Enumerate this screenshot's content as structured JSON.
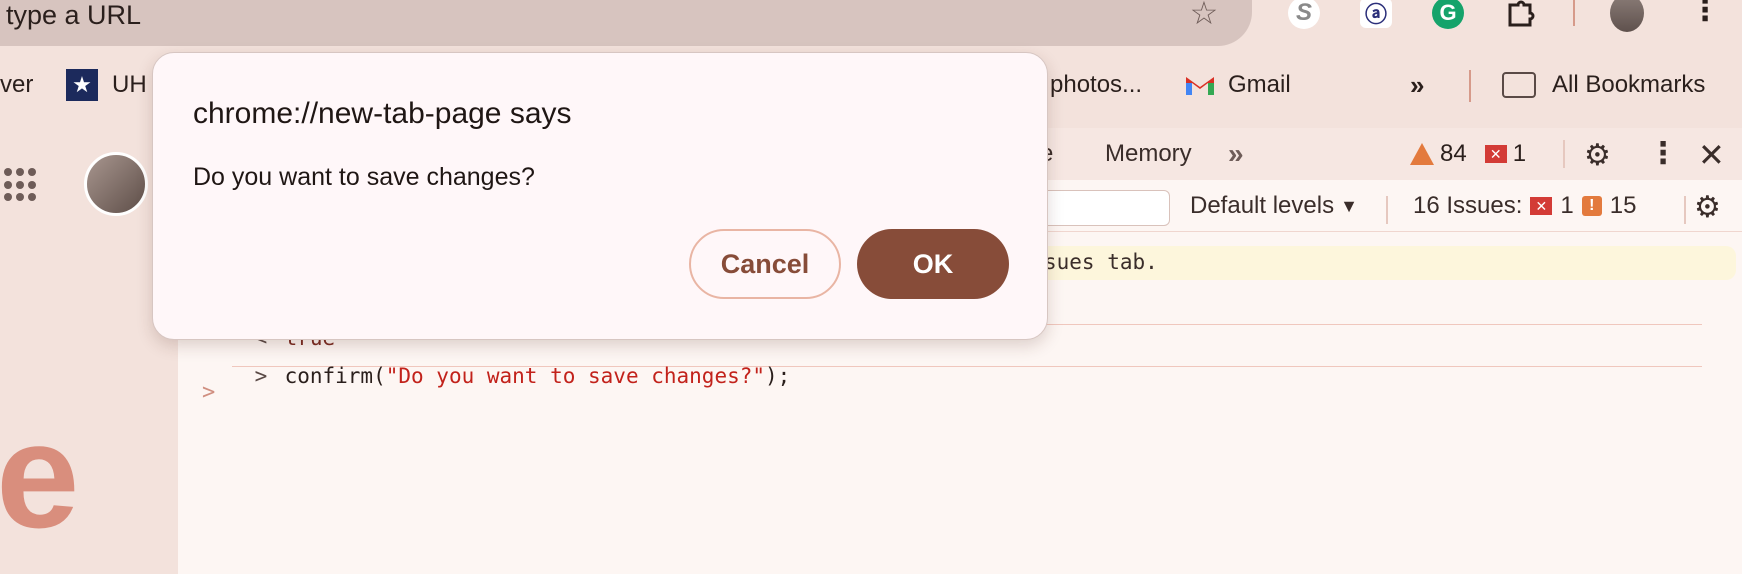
{
  "omnibox": {
    "text": "type a URL"
  },
  "bookmarks": {
    "ver_label": "ver",
    "uh_label": "UH",
    "photos_label": "photos...",
    "gmail_label": "Gmail",
    "more_label": "»",
    "all_label": "All Bookmarks"
  },
  "devtools": {
    "tab_partial": "e",
    "memory_tab": "Memory",
    "more_tabs": "»",
    "warnings_count": "84",
    "errors_count": "1",
    "default_levels": "Default levels",
    "issues_label": "16 Issues:",
    "issues_errors": "1",
    "issues_warnings": "15",
    "banner_text": "sues tab."
  },
  "console": {
    "result_prefix": "<·",
    "result_value": "true",
    "input_prefix": ">",
    "input_fn": "confirm(",
    "input_string": "\"Do you want to save changes?\"",
    "input_tail": ");",
    "prompt": ">"
  },
  "ntp": {
    "logo_letter": "e"
  },
  "dialog": {
    "title": "chrome://new-tab-page says",
    "message": "Do you want to save changes?",
    "cancel_label": "Cancel",
    "ok_label": "OK"
  },
  "colors": {
    "accent": "#874c39",
    "error": "#d33b36",
    "warning": "#e37a3d",
    "string": "#c2221b"
  }
}
